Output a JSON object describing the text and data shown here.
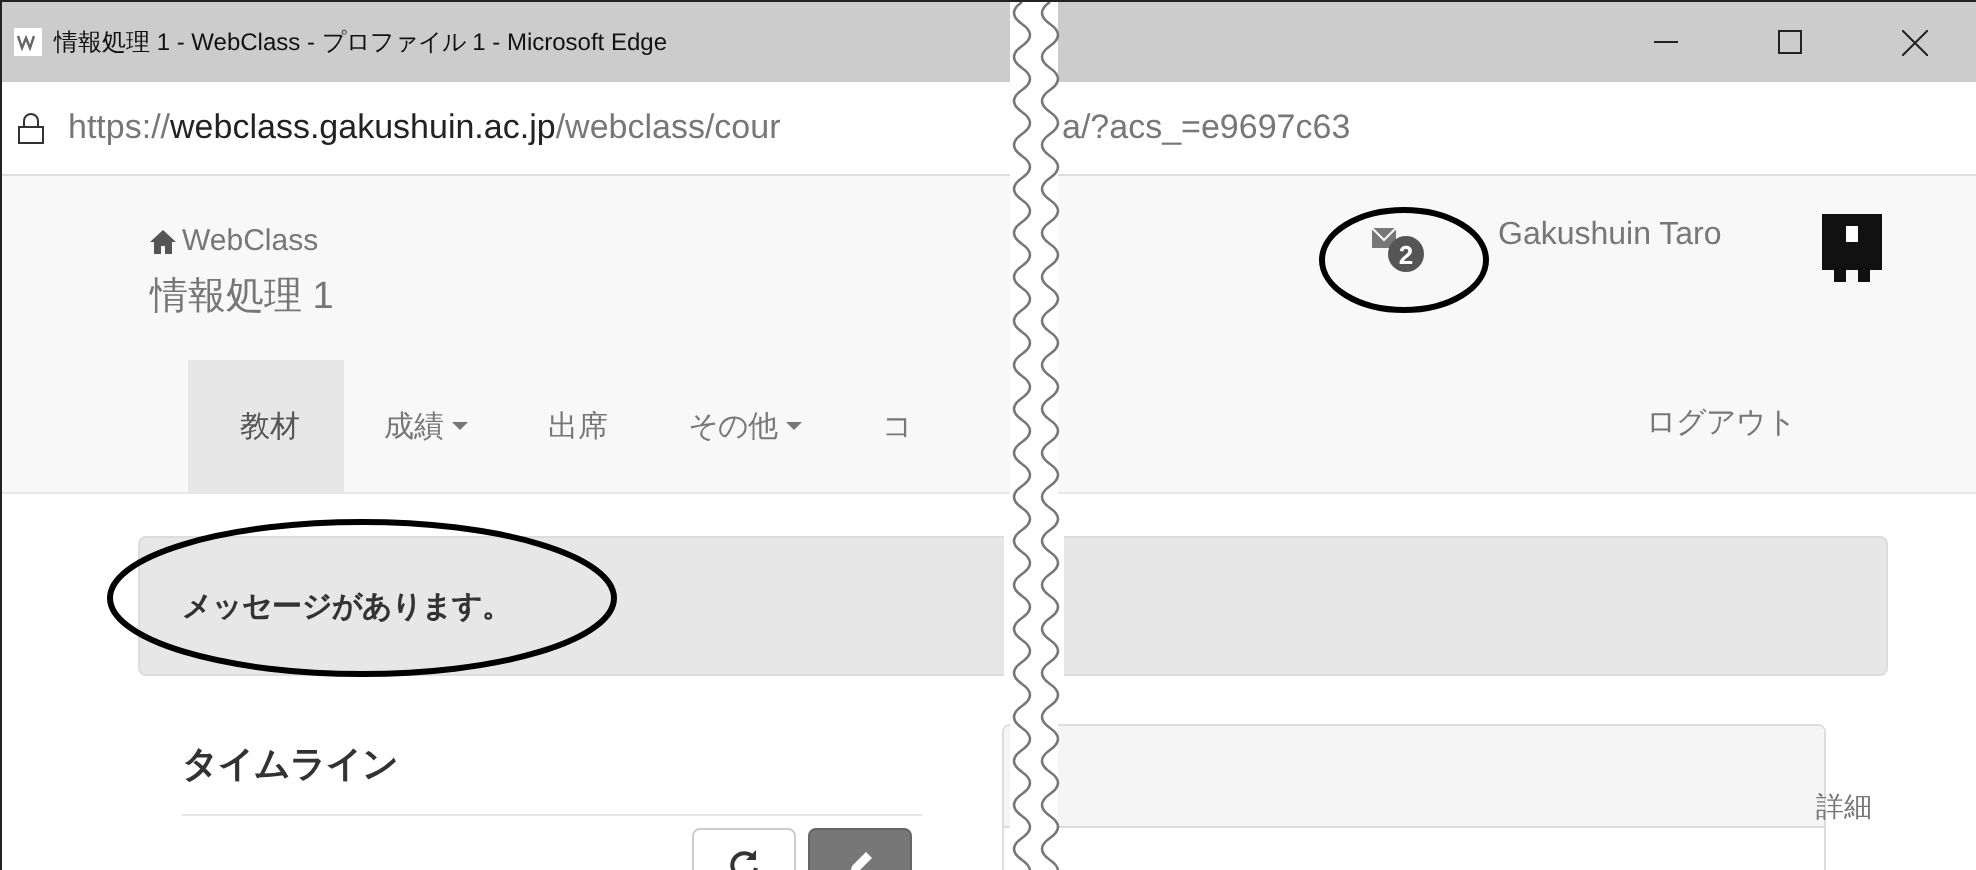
{
  "window": {
    "title": "情報処理 1  - WebClass - プロファイル 1 - Microsoft Edge"
  },
  "address_bar": {
    "url_start": "https://**webclass.gakushuin.ac.jp**/webclass/cour",
    "url_end": "a/?acs_=e9697c63"
  },
  "header": {
    "brand": "WebClass",
    "course": "情報処理 1",
    "message_count": "2",
    "user": "Gakushuin Taro"
  },
  "nav": {
    "items": [
      {
        "label": "教材",
        "selected": true,
        "dropdown": false
      },
      {
        "label": "成績",
        "selected": false,
        "dropdown": true
      },
      {
        "label": "出席",
        "selected": false,
        "dropdown": false
      },
      {
        "label": "その他",
        "selected": false,
        "dropdown": true
      },
      {
        "label": "コ",
        "selected": false,
        "dropdown": false
      }
    ],
    "logout": "ログアウト"
  },
  "alert": {
    "text": "メッセージがあります。"
  },
  "timeline": {
    "title": "タイムライン"
  },
  "panel": {
    "link": "詳細"
  }
}
